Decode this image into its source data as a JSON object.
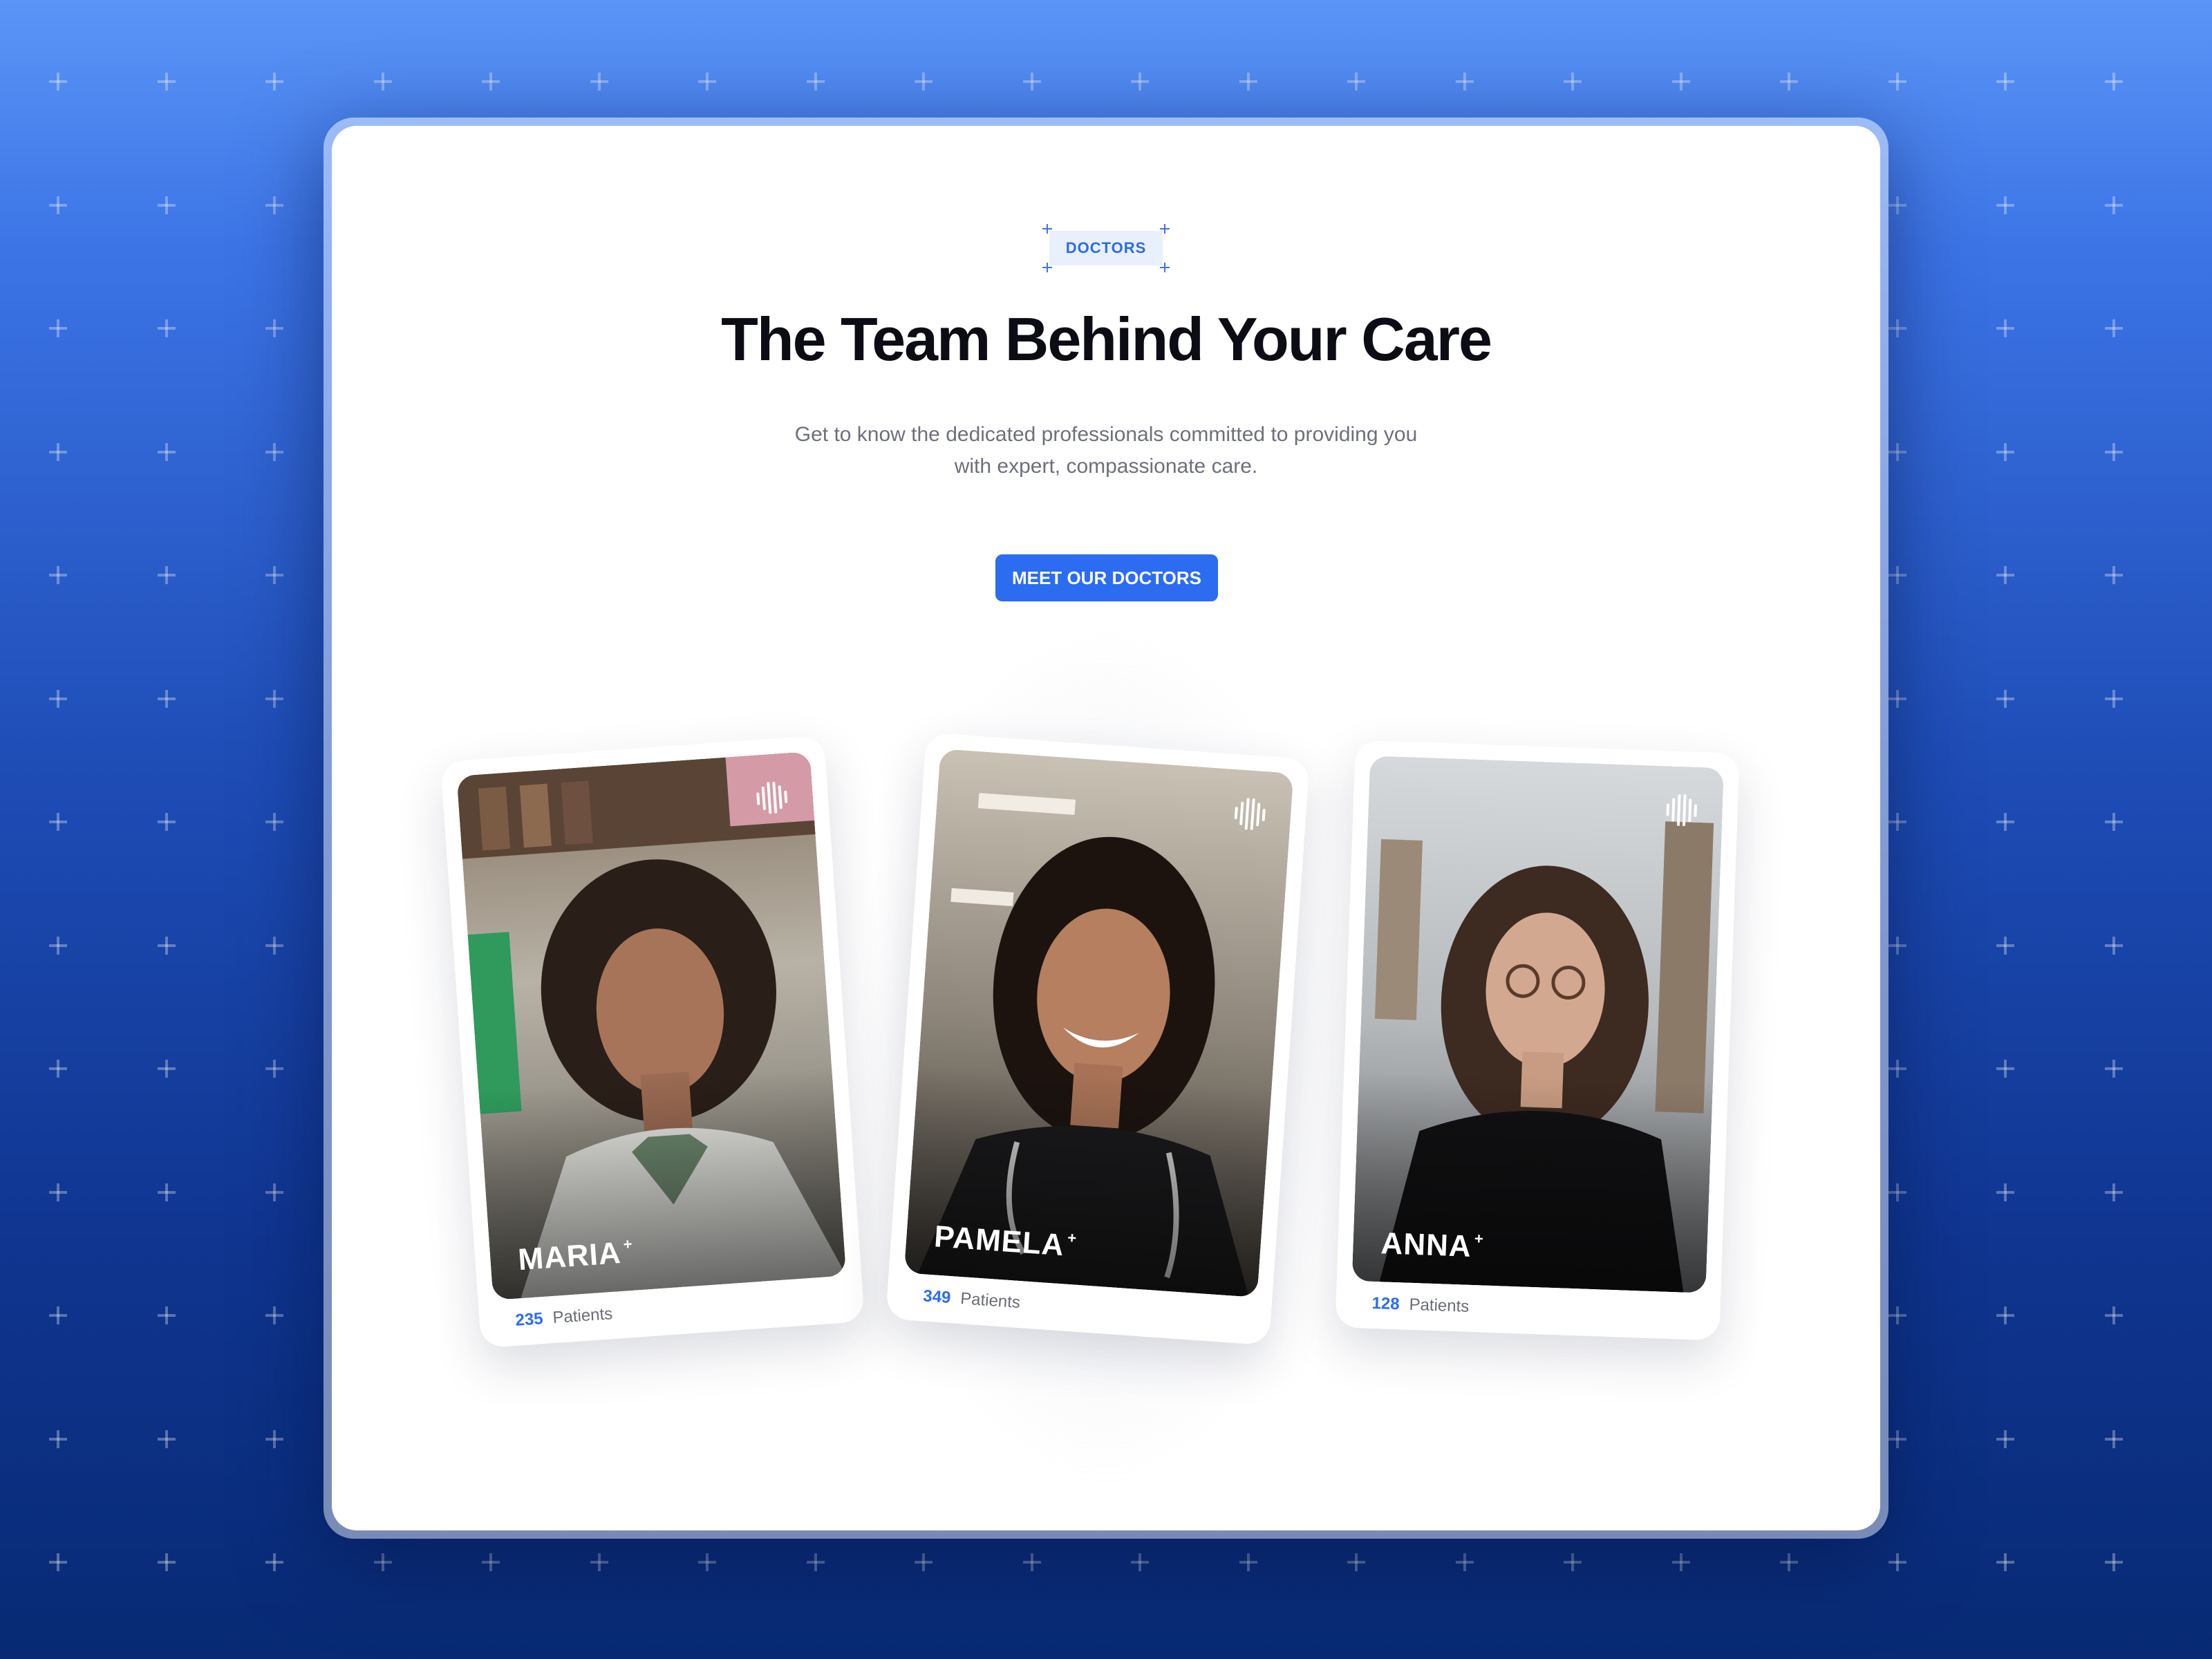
{
  "section": {
    "badge": "DOCTORS",
    "title": "The Team Behind Your Care",
    "subtitle_line1": "Get to know the dedicated professionals committed to providing you",
    "subtitle_line2": "with expert, compassionate care.",
    "cta_label": "MEET OUR DOCTORS"
  },
  "doctors": [
    {
      "name": "MARIA",
      "patients": "235",
      "patients_label": "Patients"
    },
    {
      "name": "PAMELA",
      "patients": "349",
      "patients_label": "Patients"
    },
    {
      "name": "ANNA",
      "patients": "128",
      "patients_label": "Patients"
    }
  ],
  "colors": {
    "accent": "#2b6cf0",
    "background_top": "#5b95f7",
    "background_bottom": "#082a74",
    "badge_bg": "#e8f0fd"
  },
  "icons": [
    "plus-pattern-icon",
    "brand-logo-icon",
    "sparkle-icon"
  ]
}
